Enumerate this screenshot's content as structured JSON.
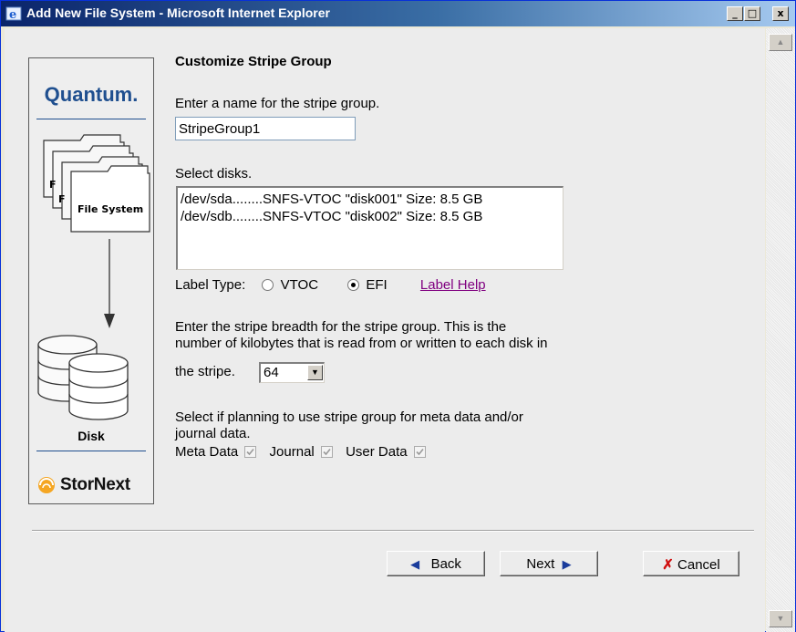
{
  "window": {
    "title": "Add New File System - Microsoft Internet Explorer",
    "controls": {
      "minimize": "_",
      "maximize": "□",
      "close": "x"
    }
  },
  "sidebar": {
    "logo": "Quantum.",
    "file_system_label": "File System",
    "disk_label": "Disk",
    "product_logo": "StorNext"
  },
  "form": {
    "heading": "Customize Stripe Group",
    "name_label": "Enter a name for the stripe group.",
    "name_value": "StripeGroup1",
    "disks_label": "Select disks.",
    "disks": [
      "/dev/sda........SNFS-VTOC \"disk001\" Size: 8.5 GB",
      "/dev/sdb........SNFS-VTOC \"disk002\" Size: 8.5 GB"
    ],
    "label_type": {
      "label": "Label Type:",
      "options": [
        "VTOC",
        "EFI"
      ],
      "selected": "EFI",
      "help_link": "Label Help"
    },
    "breadth": {
      "line1": "Enter the stripe breadth for the stripe group. This is the",
      "line2": "number of kilobytes that is read from or written to each disk in",
      "line3": "the stripe.",
      "value": "64"
    },
    "usage": {
      "line1": "Select if planning to use stripe group for meta data and/or",
      "line2": "journal data.",
      "options": [
        {
          "label": "Meta Data",
          "checked": true
        },
        {
          "label": "Journal",
          "checked": true
        },
        {
          "label": "User Data",
          "checked": true
        }
      ]
    }
  },
  "buttons": {
    "back": "Back",
    "next": "Next",
    "cancel": "Cancel"
  },
  "colors": {
    "titlebar": "#0a246a",
    "quantum_blue": "#1f4f8f",
    "link_visited": "#800080",
    "cancel_x": "#d01010"
  }
}
